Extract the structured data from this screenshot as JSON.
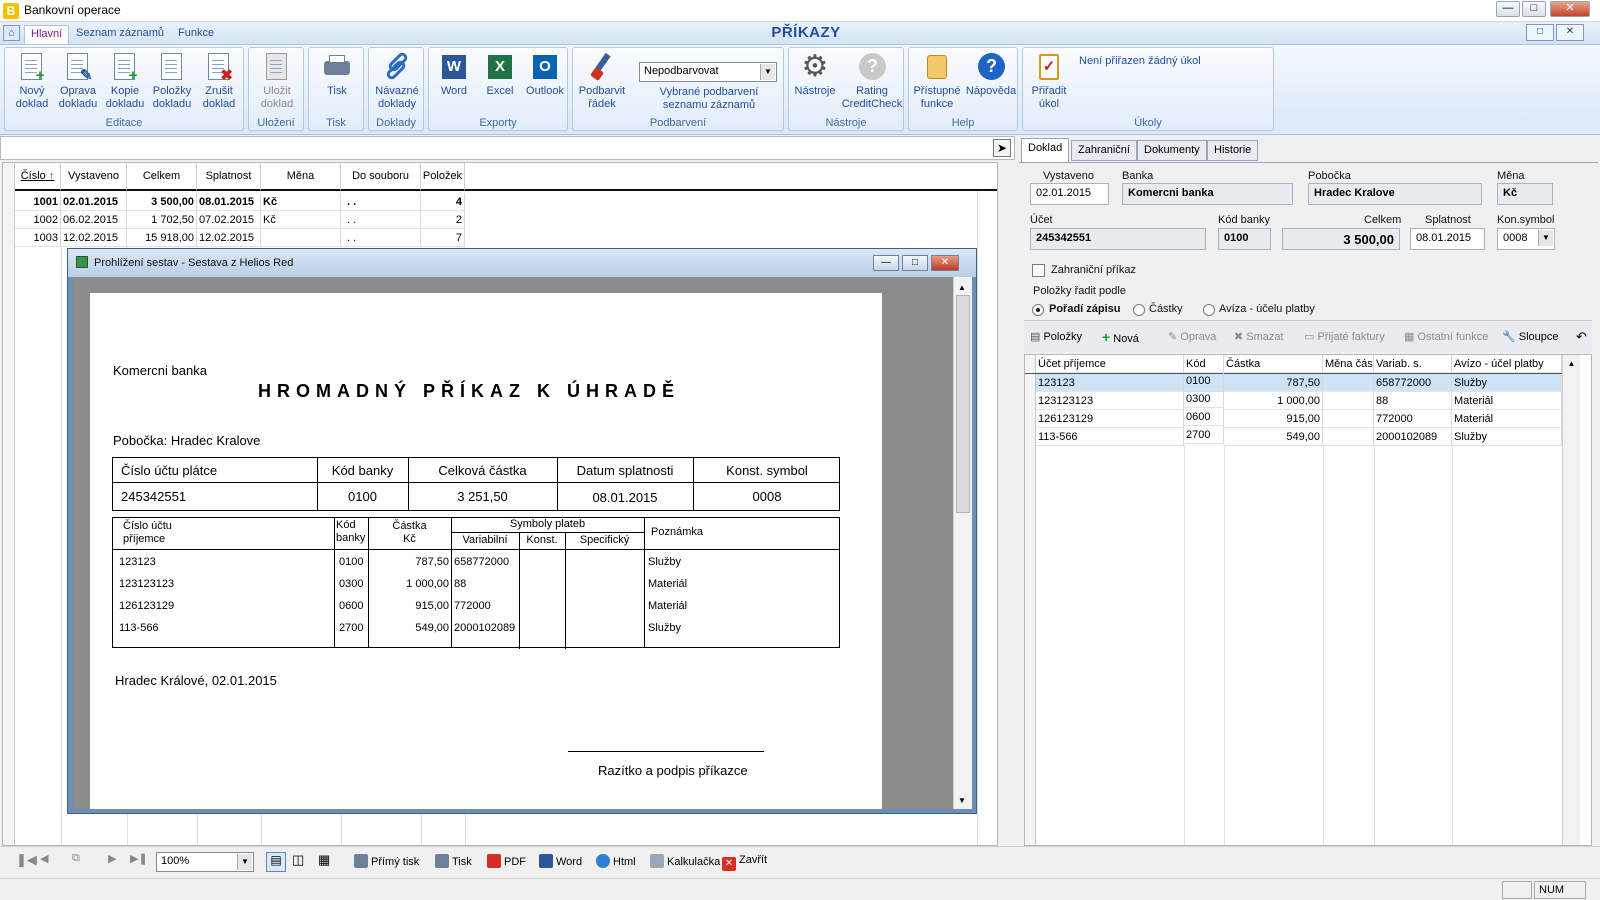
{
  "window": {
    "title": "Bankovní operace",
    "logo_letter": "B"
  },
  "menu": {
    "tabs": [
      "Hlavní",
      "Seznam záznamů",
      "Funkce"
    ],
    "app_title": "PŘÍKAZY"
  },
  "ribbon": {
    "editace": {
      "label": "Editace",
      "buttons": [
        "Nový doklad",
        "Oprava dokladu",
        "Kopie dokladu",
        "Položky dokladu",
        "Zrušit doklad"
      ]
    },
    "ulozeni": {
      "label": "Uložení",
      "button": "Uložit doklad"
    },
    "tisk": {
      "label": "Tisk",
      "button": "Tisk"
    },
    "doklady": {
      "label": "Doklady",
      "button": "Návazné doklady"
    },
    "exporty": {
      "label": "Exporty",
      "buttons": [
        "Word",
        "Excel",
        "Outlook"
      ]
    },
    "podbarveni": {
      "label": "Podbarvení",
      "button": "Podbarvit řádek",
      "select_value": "Nepodbarvovat",
      "caption": "Vybrané podbarvení seznamu záznamů"
    },
    "nastroje": {
      "label": "Nástroje",
      "buttons": [
        "Nástroje",
        "Rating CreditCheck"
      ]
    },
    "help": {
      "label": "Help",
      "buttons": [
        "Přístupné funkce",
        "Nápověda"
      ]
    },
    "ukoly": {
      "label": "Úkoly",
      "button": "Přiřadit úkol",
      "message": "Není přiřazen žádný úkol"
    }
  },
  "grid": {
    "columns": [
      "Číslo",
      "Vystaveno",
      "Celkem",
      "Splatnost",
      "Měna",
      "Do souboru",
      "Položek"
    ],
    "rows": [
      {
        "cislo": "1001",
        "vystaveno": "02.01.2015",
        "celkem": "3 500,00",
        "splatnost": "08.01.2015",
        "mena": "Kč",
        "dosouboru": ". .",
        "polozek": "4"
      },
      {
        "cislo": "1002",
        "vystaveno": "06.02.2015",
        "celkem": "1 702,50",
        "splatnost": "07.02.2015",
        "mena": "Kč",
        "dosouboru": ". .",
        "polozek": "2"
      },
      {
        "cislo": "1003",
        "vystaveno": "12.02.2015",
        "celkem": "15 918,00",
        "splatnost": "12.02.2015",
        "mena": "",
        "dosouboru": ". .",
        "polozek": "7"
      }
    ]
  },
  "report": {
    "window_title": "Prohlížení sestav - Sestava z Helios Red",
    "bank": "Komercni banka",
    "heading": "HROMADNÝ PŘÍKAZ K ÚHRADĚ",
    "branch": "Pobočka: Hradec Kralove",
    "head_cols": [
      "Číslo účtu plátce",
      "Kód banky",
      "Celková částka",
      "Datum splatnosti",
      "Konst. symbol"
    ],
    "head_vals": [
      "245342551",
      "0100",
      "3 251,50",
      "08.01.2015",
      "0008"
    ],
    "item_cols": {
      "ucet": "Číslo účtu",
      "prijemce": "příjemce",
      "kod": "Kód",
      "banky": "banky",
      "castka": "Částka",
      "kc": "Kč",
      "symboly": "Symboly plateb",
      "variabilni": "Variabilní",
      "konst": "Konst.",
      "specificky": "Specifický",
      "poznamka": "Poznámka"
    },
    "items": [
      {
        "ucet": "123123",
        "kod": "0100",
        "castka": "787,50",
        "vs": "658772000",
        "pozn": "Služby"
      },
      {
        "ucet": "123123123",
        "kod": "0300",
        "castka": "1 000,00",
        "vs": "88",
        "pozn": "Materiál"
      },
      {
        "ucet": "126123129",
        "kod": "0600",
        "castka": "915,00",
        "vs": "772000",
        "pozn": "Materiál"
      },
      {
        "ucet": "113-566",
        "kod": "2700",
        "castka": "549,00",
        "vs": "2000102089",
        "pozn": "Služby"
      }
    ],
    "place_date": "Hradec Králové, 02.01.2015",
    "signature": "Razítko a podpis příkazce"
  },
  "detail": {
    "tabs": [
      "Doklad",
      "Zahraniční",
      "Dokumenty",
      "Historie"
    ],
    "labels": {
      "vystaveno": "Vystaveno",
      "banka": "Banka",
      "pobocka": "Pobočka",
      "mena": "Měna",
      "ucet": "Účet",
      "kod_banky": "Kód banky",
      "celkem": "Celkem",
      "splatnost": "Splatnost",
      "kon_symbol": "Kon.symbol"
    },
    "values": {
      "vystaveno": "02.01.2015",
      "banka": "Komercni banka",
      "pobocka": "Hradec Kralove",
      "mena": "Kč",
      "ucet": "245342551",
      "kod_banky": "0100",
      "celkem": "3 500,00",
      "splatnost": "08.01.2015",
      "kon_symbol": "0008"
    },
    "foreign_label": "Zahraniční příkaz",
    "sort_label": "Položky řadit podle",
    "sort_options": [
      "Pořadí zápisu",
      "Částky",
      "Avíza - účelu platby"
    ],
    "toolbar": [
      "Položky",
      "Nová",
      "Oprava",
      "Smazat",
      "Přijaté faktury",
      "Ostatní funkce",
      "Sloupce"
    ],
    "item_columns": [
      "Účet příjemce",
      "Kód",
      "Částka",
      "Měna část",
      "Variab. s.",
      "Avízo - účel platby"
    ],
    "items": [
      {
        "ucet": "123123",
        "kod": "0100",
        "castka": "787,50",
        "vs": "658772000",
        "avizo": "Služby"
      },
      {
        "ucet": "123123123",
        "kod": "0300",
        "castka": "1 000,00",
        "vs": "88",
        "avizo": "Materiál"
      },
      {
        "ucet": "126123129",
        "kod": "0600",
        "castka": "915,00",
        "vs": "772000",
        "avizo": "Materiál"
      },
      {
        "ucet": "113-566",
        "kod": "2700",
        "castka": "549,00",
        "vs": "2000102089",
        "avizo": "Služby"
      }
    ]
  },
  "bottombar": {
    "zoom": "100%",
    "buttons": [
      "Přímý tisk",
      "Tisk",
      "PDF",
      "Word",
      "Html",
      "Kalkulačka",
      "Zavřít"
    ]
  },
  "statusbar": {
    "num": "NUM"
  },
  "colors": {
    "accent": "#1f4e9c",
    "selected_row": "#cde4f7",
    "ribbon": "#dce8f6"
  }
}
